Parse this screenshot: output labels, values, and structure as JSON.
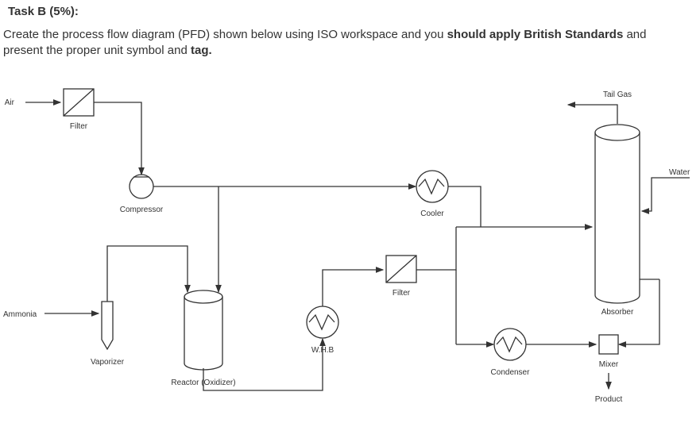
{
  "header": {
    "task_title": "Task B (5%):",
    "instruction_pre": "Create the process flow diagram (PFD) shown below using ISO workspace and you ",
    "instruction_bold1": "should apply British Standards",
    "instruction_mid": " and present the proper unit symbol and ",
    "instruction_bold2": "tag.",
    "instruction_post": ""
  },
  "diagram": {
    "inputs": {
      "air": "Air",
      "ammonia": "Ammonia",
      "water": "Water"
    },
    "outputs": {
      "tail_gas": "Tail Gas",
      "product": "Product"
    },
    "units": {
      "filter1": "Filter",
      "compressor": "Compressor",
      "vaporizer": "Vaporizer",
      "reactor": "Reactor (Oxidizer)",
      "whb": "W.H.B",
      "filter2": "Filter",
      "cooler": "Cooler",
      "condenser": "Condenser",
      "absorber": "Absorber",
      "mixer": "Mixer"
    }
  }
}
